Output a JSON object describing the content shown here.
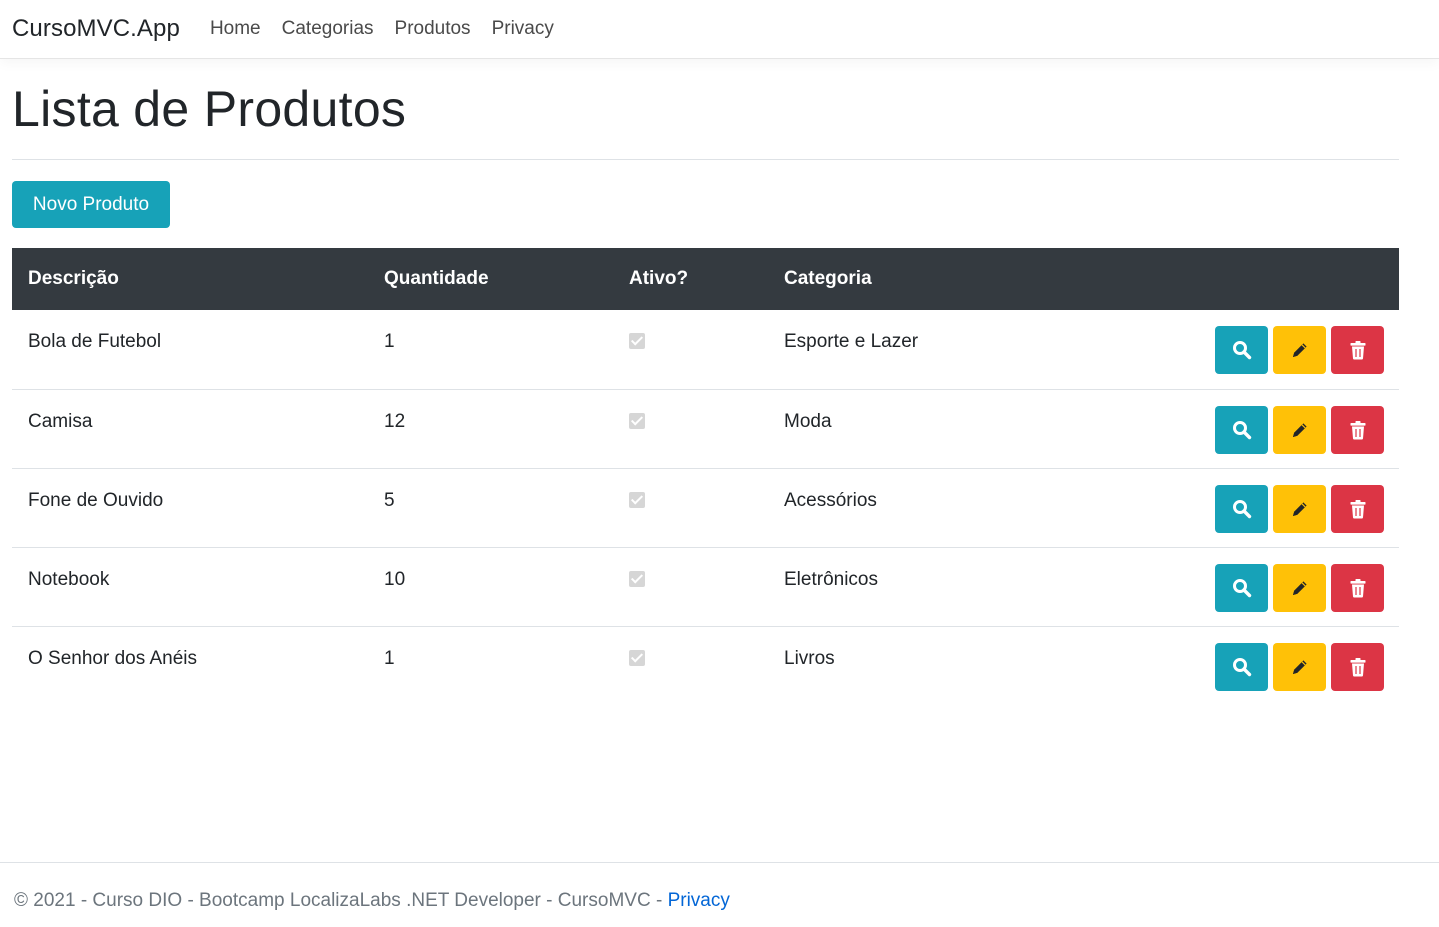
{
  "navbar": {
    "brand": "CursoMVC.App",
    "links": [
      "Home",
      "Categorias",
      "Produtos",
      "Privacy"
    ]
  },
  "page": {
    "title": "Lista de Produtos",
    "new_button": "Novo Produto"
  },
  "table": {
    "headers": [
      "Descrição",
      "Quantidade",
      "Ativo?",
      "Categoria"
    ],
    "rows": [
      {
        "descricao": "Bola de Futebol",
        "quantidade": "1",
        "ativo": true,
        "categoria": "Esporte e Lazer"
      },
      {
        "descricao": "Camisa",
        "quantidade": "12",
        "ativo": true,
        "categoria": "Moda"
      },
      {
        "descricao": "Fone de Ouvido",
        "quantidade": "5",
        "ativo": true,
        "categoria": "Acessórios"
      },
      {
        "descricao": "Notebook",
        "quantidade": "10",
        "ativo": true,
        "categoria": "Eletrônicos"
      },
      {
        "descricao": "O Senhor dos Anéis",
        "quantidade": "1",
        "ativo": true,
        "categoria": "Livros"
      }
    ],
    "actions": [
      "search-icon",
      "pencil-icon",
      "trash-icon"
    ]
  },
  "footer": {
    "text": "© 2021 - Curso DIO - Bootcamp LocalizaLabs .NET Developer - CursoMVC - ",
    "link": "Privacy"
  },
  "colors": {
    "info": "#17a2b8",
    "warning": "#ffc107",
    "danger": "#dc3545",
    "table_header": "#343a40",
    "link": "#0366d6"
  }
}
